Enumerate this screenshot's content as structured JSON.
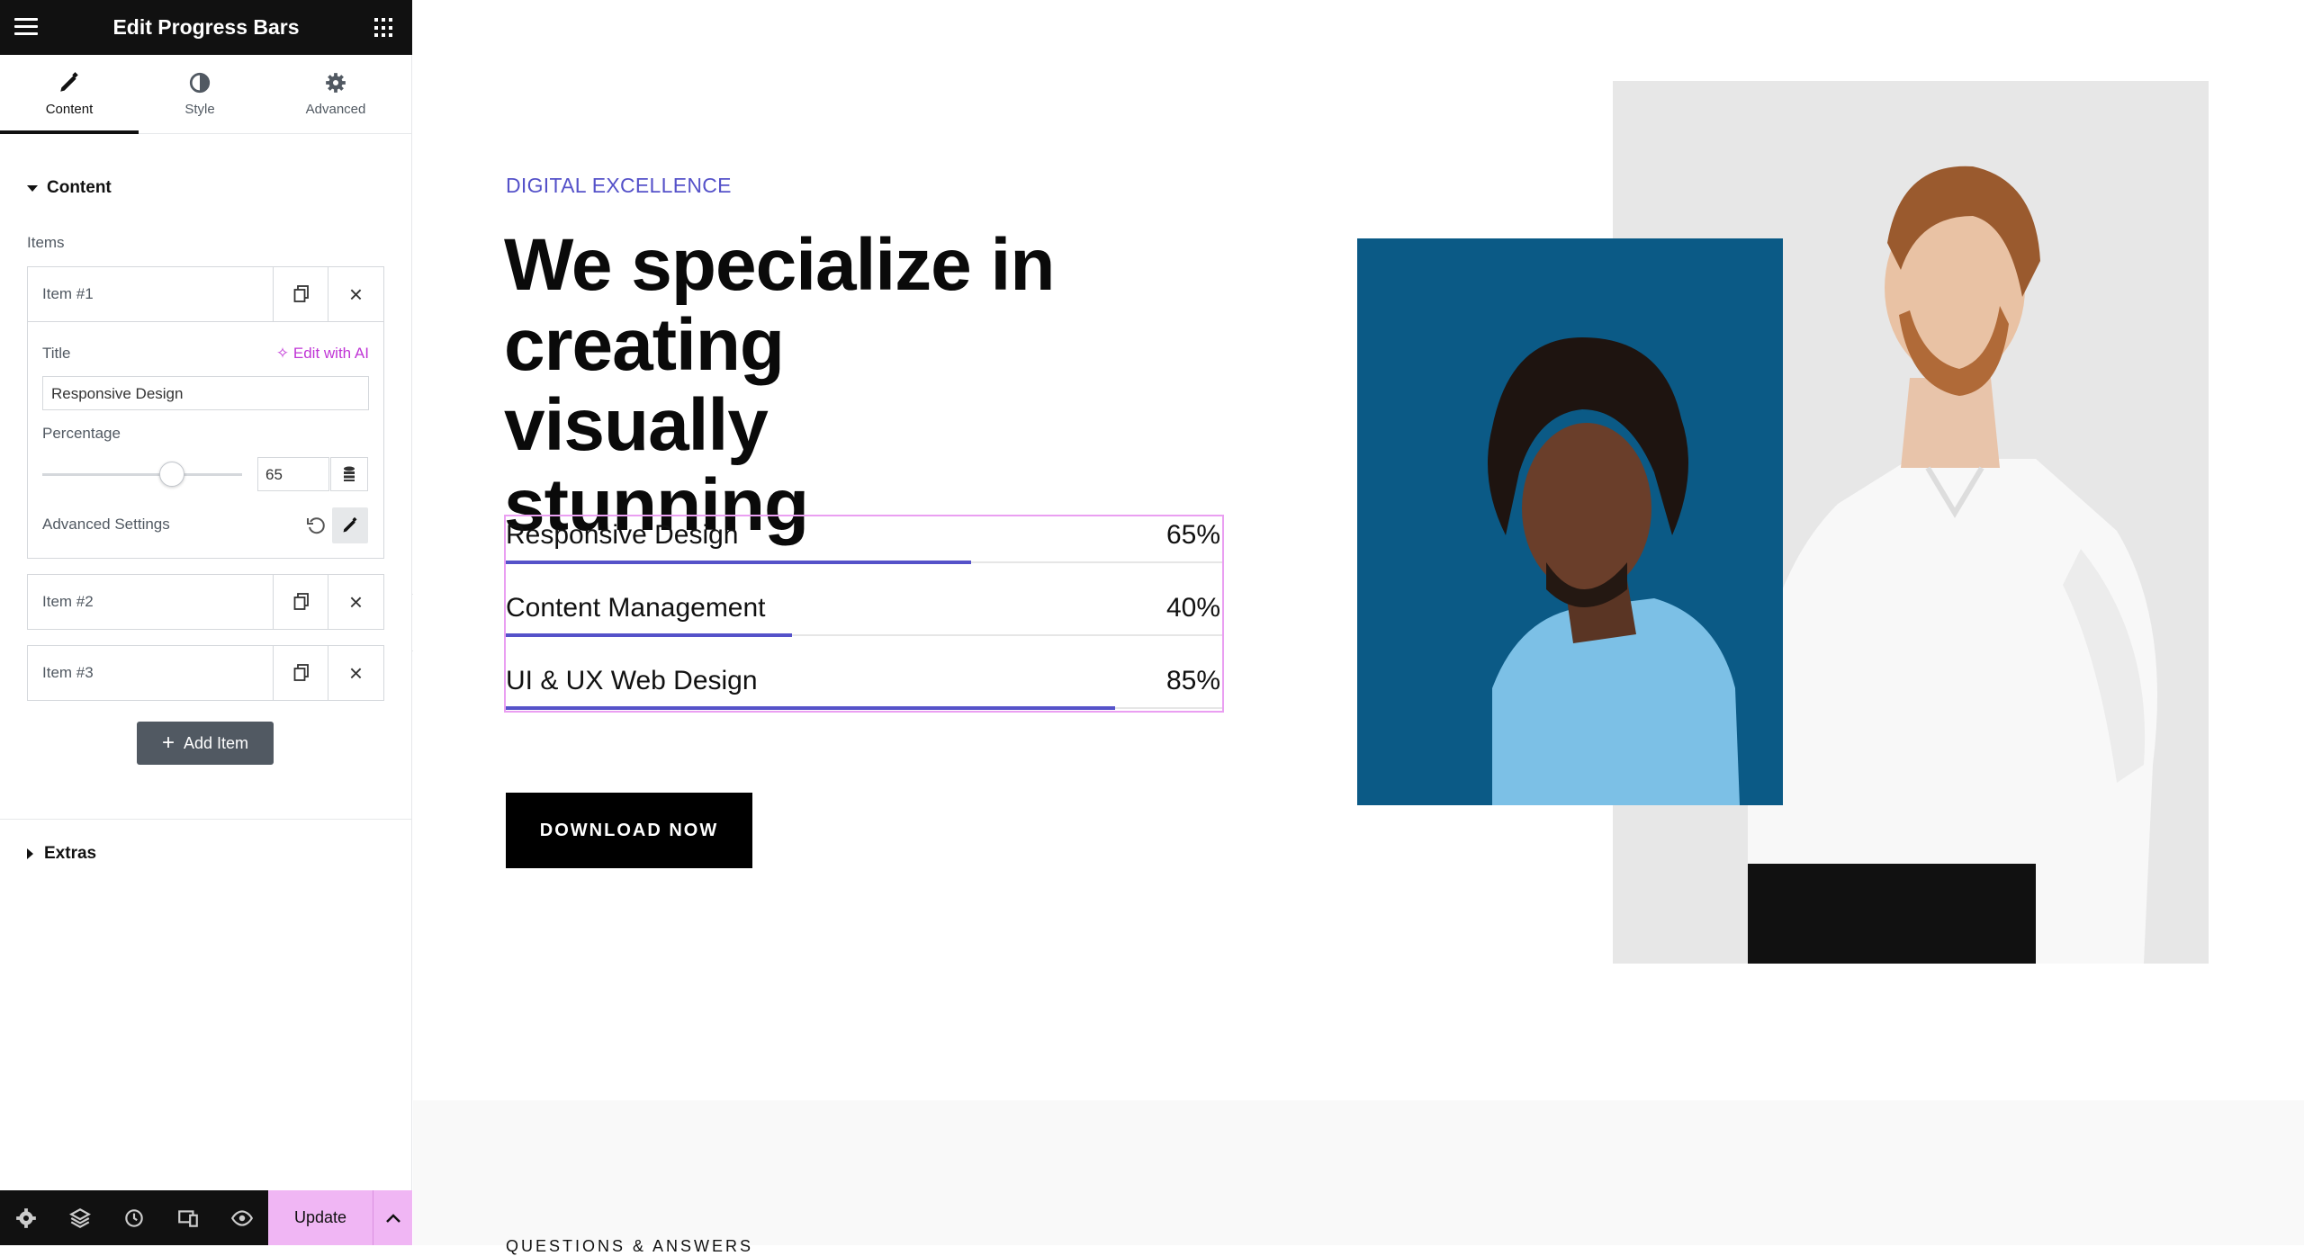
{
  "editor": {
    "title": "Edit Progress Bars",
    "tabs": [
      {
        "label": "Content"
      },
      {
        "label": "Style"
      },
      {
        "label": "Advanced"
      }
    ],
    "content_section": "Content",
    "items_label": "Items",
    "items": [
      {
        "name": "Item #1"
      },
      {
        "name": "Item #2"
      },
      {
        "name": "Item #3"
      }
    ],
    "item1": {
      "title_label": "Title",
      "edit_ai": "Edit with AI",
      "title_value": "Responsive Design",
      "percentage_label": "Percentage",
      "percentage_value": "65",
      "slider_fraction": 0.65,
      "advanced_label": "Advanced Settings"
    },
    "add_item": "Add Item",
    "extras_section": "Extras",
    "update": "Update"
  },
  "page": {
    "eyebrow": "DIGITAL EXCELLENCE",
    "heading": "We specialize in creating visually stunning",
    "bars": [
      {
        "title": "Responsive Design",
        "percent_label": "65%",
        "percent": 65
      },
      {
        "title": "Content Management",
        "percent_label": "40%",
        "percent": 40
      },
      {
        "title": "UI & UX Web Design",
        "percent_label": "85%",
        "percent": 85
      }
    ],
    "cta": "DOWNLOAD NOW",
    "next_section": "QUESTIONS & ANSWERS"
  },
  "colors": {
    "accent": "#5552c9",
    "update_bg": "#f0b6f4",
    "ai_link": "#c036d6",
    "photo_blue": "#0b5a86"
  }
}
